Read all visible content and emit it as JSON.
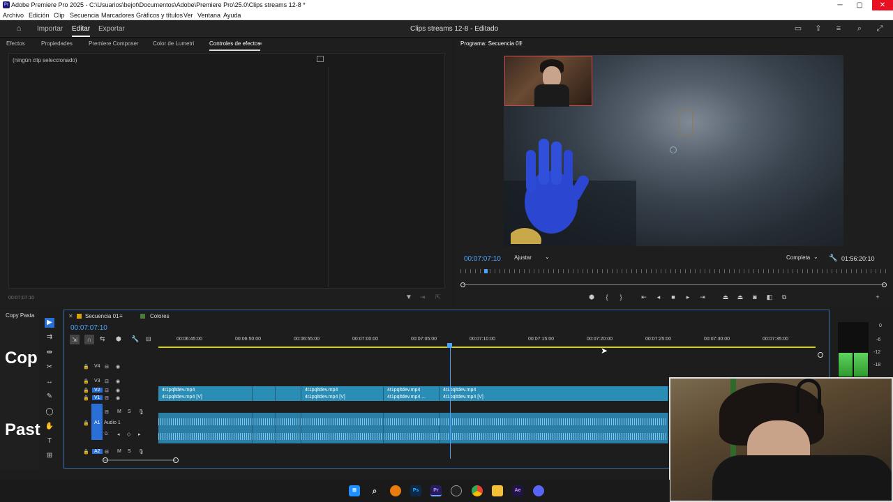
{
  "titlebar": {
    "app_icon": "Pr",
    "title": "Adobe Premiere Pro 2025 - C:\\Usuarios\\bejot\\Documentos\\Adobe\\Premiere Pro\\25.0\\Clips streams 12-8 *",
    "minimize": "─",
    "maximize": "▢",
    "close": "✕"
  },
  "menubar": [
    "Archivo",
    "Edición",
    "Clip",
    "Secuencia",
    "Marcadores",
    "Gráficos y títulos",
    "Ver",
    "Ventana",
    "Ayuda"
  ],
  "appbar": {
    "tabs": [
      "Importar",
      "Editar",
      "Exportar"
    ],
    "active_tab": "Editar",
    "project": "Clips streams 12-8 - Editado"
  },
  "effect_panel": {
    "tabs": [
      "Efectos",
      "Propiedades",
      "Premiere Composer",
      "Color de Lumetri",
      "Controles de efectos"
    ],
    "no_clip": "(ningún clip seleccionado)",
    "timecode": "00:07:07:10"
  },
  "program": {
    "title": "Programa: Secuencia 01",
    "timecode": "00:07:07:10",
    "fit": "Ajustar",
    "quality": "Completa",
    "duration": "01:56:20:10"
  },
  "timeline": {
    "panel_left_label": "Copy Pasta",
    "big_text_1": "Cop",
    "big_text_2": "Past",
    "tabs": [
      "Secuencia 01",
      "Colores"
    ],
    "timecode": "00:07:07:10",
    "ruler": [
      "00:06:45:00",
      "00:06:50:00",
      "00:06:55:00",
      "00:07:00:00",
      "00:07:05:00",
      "00:07:10:00",
      "00:07:15:00",
      "00:07:20:00",
      "00:07:25:00",
      "00:07:30:00",
      "00:07:35:00"
    ],
    "tracks": [
      "V4",
      "V3",
      "V2",
      "V1",
      "A1",
      "A2"
    ],
    "audio_label": "Audio 1",
    "clip_top": "4t1pqltdev.mp4",
    "clip_bottom": "4t1pqltdev.mp4 [V]",
    "clip_bottom_trunc": "4t1pqltdev.mp4 ...",
    "meter_labels": [
      "0",
      "-6",
      "-12",
      "-18"
    ]
  },
  "taskbar": [
    "windows-icon",
    "search-icon",
    "blender-icon",
    "photoshop-icon",
    "premiere-icon",
    "obs-icon",
    "chrome-icon",
    "explorer-icon",
    "after-effects-icon",
    "discord-icon"
  ]
}
